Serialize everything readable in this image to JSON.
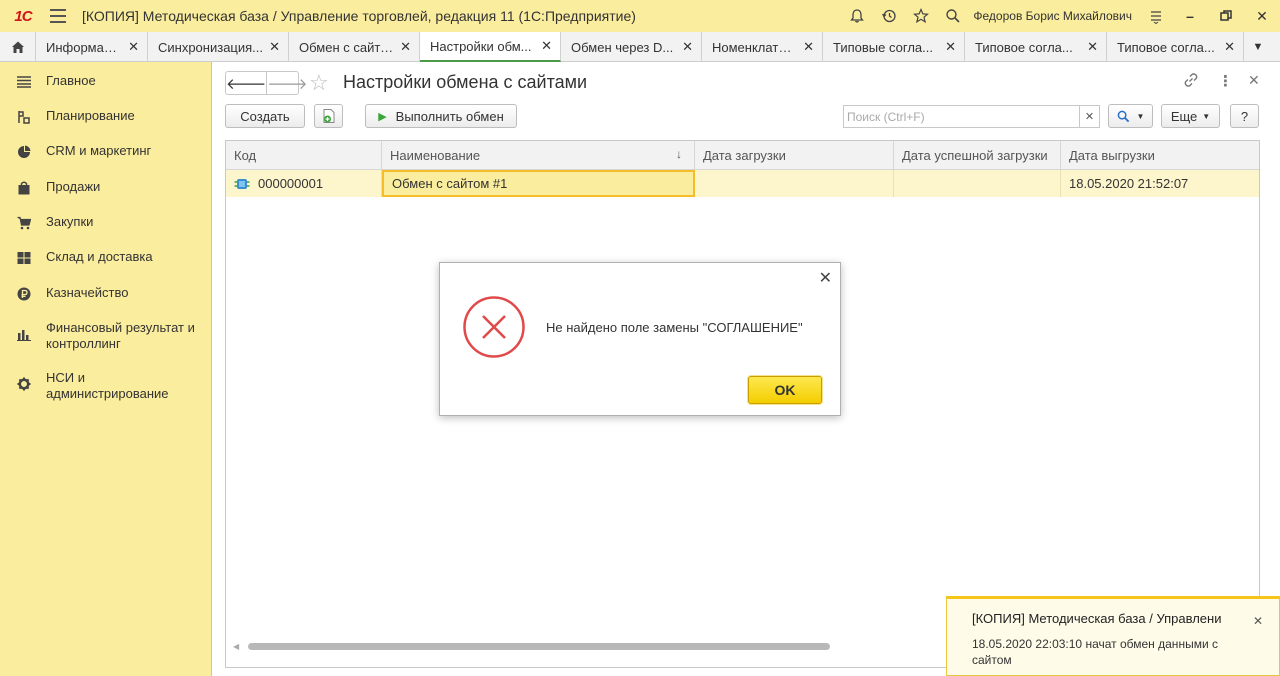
{
  "app": {
    "logo": "1С",
    "title": "[КОПИЯ] Методическая база / Управление торговлей, редакция 11  (1С:Предприятие)",
    "user": "Федоров Борис Михайлович"
  },
  "tabs": [
    {
      "label": "Информация"
    },
    {
      "label": "Синхронизация..."
    },
    {
      "label": "Обмен с сайтом"
    },
    {
      "label": "Настройки обм..."
    },
    {
      "label": "Обмен через D..."
    },
    {
      "label": "Номенклатура"
    },
    {
      "label": "Типовые согла..."
    },
    {
      "label": "Типовое согла..."
    },
    {
      "label": "Типовое согла..."
    }
  ],
  "sidebar": {
    "items": [
      {
        "label": "Главное",
        "icon": "menu-lines-icon"
      },
      {
        "label": "Планирование",
        "icon": "planning-icon"
      },
      {
        "label": "CRM и маркетинг",
        "icon": "pie-chart-icon"
      },
      {
        "label": "Продажи",
        "icon": "bag-icon"
      },
      {
        "label": "Закупки",
        "icon": "cart-icon"
      },
      {
        "label": "Склад и доставка",
        "icon": "warehouse-icon"
      },
      {
        "label": "Казначейство",
        "icon": "ruble-icon"
      },
      {
        "label": "Финансовый результат и контроллинг",
        "icon": "bar-chart-icon"
      },
      {
        "label": "НСИ и администрирование",
        "icon": "gear-icon"
      }
    ]
  },
  "form": {
    "title": "Настройки обмена с сайтами",
    "create_label": "Создать",
    "run_label": "Выполнить обмен",
    "search_placeholder": "Поиск (Ctrl+F)",
    "more_label": "Еще",
    "help_label": "?"
  },
  "table": {
    "columns": [
      "Код",
      "Наименование",
      "Дата загрузки",
      "Дата успешной загрузки",
      "Дата выгрузки"
    ],
    "rows": [
      {
        "code": "000000001",
        "name": "Обмен с сайтом #1",
        "load_date": "",
        "success_load_date": "",
        "unload_date": "18.05.2020 21:52:07"
      }
    ]
  },
  "dialog": {
    "message": "Не найдено поле замены \"СОГЛАШЕНИЕ\"",
    "ok_label": "OK"
  },
  "notification": {
    "title": "[КОПИЯ] Методическая база / Управлени",
    "text": "18.05.2020 22:03:10 начат обмен данными с сайтом"
  },
  "colors": {
    "accent_yellow": "#fbed9e",
    "ok_button": "#f4cd00",
    "error_red": "#e04a4a",
    "active_tab_underline": "#4a9a48"
  }
}
